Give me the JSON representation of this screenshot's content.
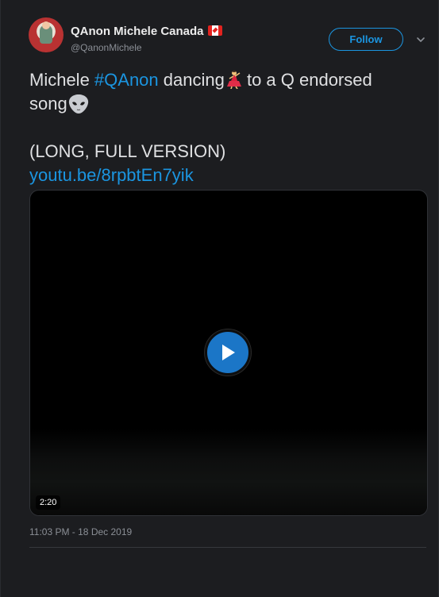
{
  "tweet": {
    "author": {
      "display_name": "QAnon Michele Canada",
      "flag_icon": "canada-flag-icon",
      "handle": "@QanonMichele"
    },
    "follow_label": "Follow",
    "menu_icon": "chevron-down-icon",
    "text": {
      "part1": "Michele ",
      "hashtag": "#QAnon",
      "part2": " dancing",
      "emoji1": "dancer-emoji-icon",
      "part3": " to a Q endorsed\nsong",
      "emoji2": "alien-emoji-icon",
      "part4": "\n\n(LONG, FULL VERSION)\n",
      "link": "youtu.be/8rpbtEn7yik"
    },
    "video": {
      "play_icon": "play-icon",
      "duration": "2:20"
    },
    "timestamp": "11:03 PM - 18 Dec 2019"
  },
  "colors": {
    "background": "#1c1d20",
    "accent": "#1b95e0",
    "text": "#dfe0e2",
    "muted": "#8b8f96"
  }
}
